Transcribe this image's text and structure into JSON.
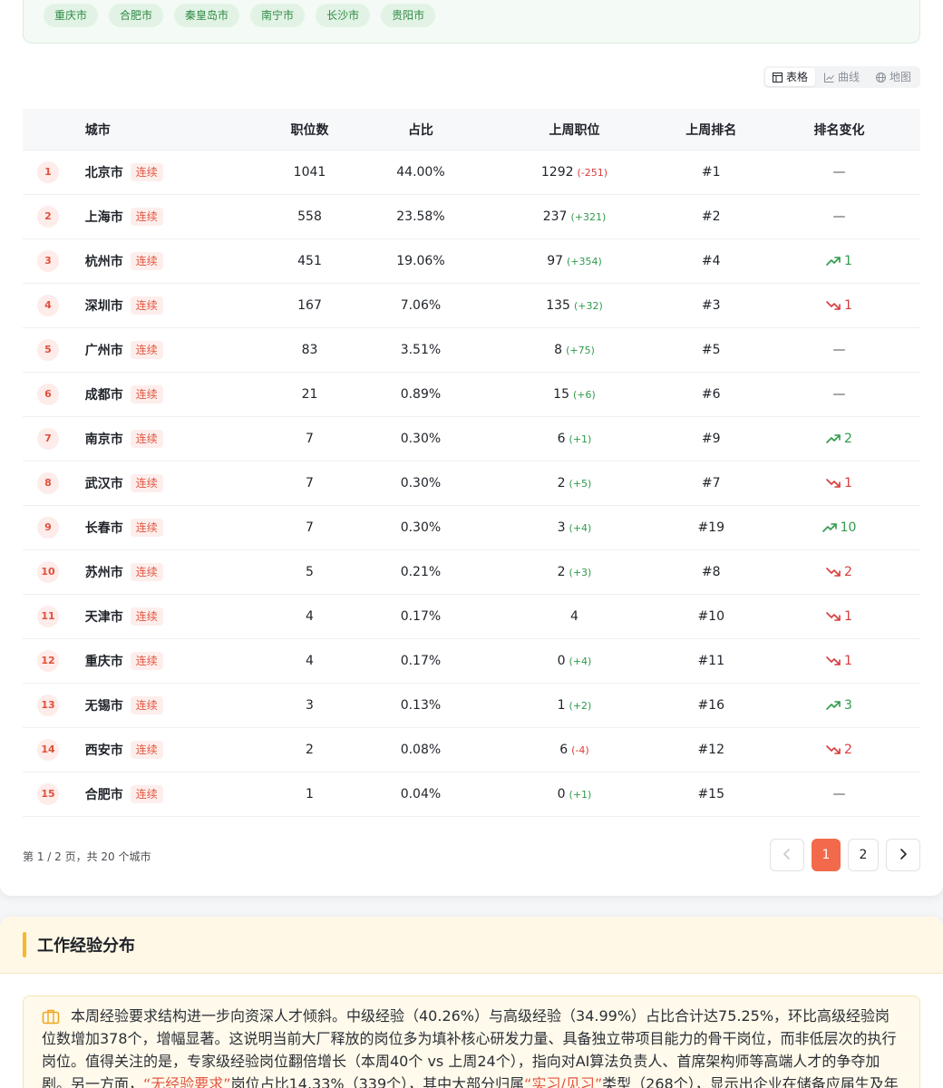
{
  "city_chips": [
    "重庆市",
    "合肥市",
    "秦皇岛市",
    "南宁市",
    "长沙市",
    "贵阳市"
  ],
  "view_toggle": [
    {
      "label": "表格",
      "icon": "table-icon",
      "active": true
    },
    {
      "label": "曲线",
      "icon": "line-chart-icon",
      "active": false
    },
    {
      "label": "地图",
      "icon": "globe-icon",
      "active": false
    }
  ],
  "table": {
    "headers": {
      "city": "城市",
      "jobs": "职位数",
      "share": "占比",
      "last_jobs": "上周职位",
      "last_rank": "上周排名",
      "rank_change": "排名变化"
    },
    "tag_label": "连续",
    "rows": [
      {
        "rank": "1",
        "city": "北京市",
        "jobs": "1041",
        "share": "44.00%",
        "last_jobs": "1292",
        "delta": "(-251)",
        "delta_dir": "down",
        "last_rank": "#1",
        "change": "—",
        "change_dir": "flat"
      },
      {
        "rank": "2",
        "city": "上海市",
        "jobs": "558",
        "share": "23.58%",
        "last_jobs": "237",
        "delta": "(+321)",
        "delta_dir": "up",
        "last_rank": "#2",
        "change": "—",
        "change_dir": "flat"
      },
      {
        "rank": "3",
        "city": "杭州市",
        "jobs": "451",
        "share": "19.06%",
        "last_jobs": "97",
        "delta": "(+354)",
        "delta_dir": "up",
        "last_rank": "#4",
        "change": "1",
        "change_dir": "up"
      },
      {
        "rank": "4",
        "city": "深圳市",
        "jobs": "167",
        "share": "7.06%",
        "last_jobs": "135",
        "delta": "(+32)",
        "delta_dir": "up",
        "last_rank": "#3",
        "change": "1",
        "change_dir": "down"
      },
      {
        "rank": "5",
        "city": "广州市",
        "jobs": "83",
        "share": "3.51%",
        "last_jobs": "8",
        "delta": "(+75)",
        "delta_dir": "up",
        "last_rank": "#5",
        "change": "—",
        "change_dir": "flat"
      },
      {
        "rank": "6",
        "city": "成都市",
        "jobs": "21",
        "share": "0.89%",
        "last_jobs": "15",
        "delta": "(+6)",
        "delta_dir": "up",
        "last_rank": "#6",
        "change": "—",
        "change_dir": "flat"
      },
      {
        "rank": "7",
        "city": "南京市",
        "jobs": "7",
        "share": "0.30%",
        "last_jobs": "6",
        "delta": "(+1)",
        "delta_dir": "up",
        "last_rank": "#9",
        "change": "2",
        "change_dir": "up"
      },
      {
        "rank": "8",
        "city": "武汉市",
        "jobs": "7",
        "share": "0.30%",
        "last_jobs": "2",
        "delta": "(+5)",
        "delta_dir": "up",
        "last_rank": "#7",
        "change": "1",
        "change_dir": "down"
      },
      {
        "rank": "9",
        "city": "长春市",
        "jobs": "7",
        "share": "0.30%",
        "last_jobs": "3",
        "delta": "(+4)",
        "delta_dir": "up",
        "last_rank": "#19",
        "change": "10",
        "change_dir": "up"
      },
      {
        "rank": "10",
        "city": "苏州市",
        "jobs": "5",
        "share": "0.21%",
        "last_jobs": "2",
        "delta": "(+3)",
        "delta_dir": "up",
        "last_rank": "#8",
        "change": "2",
        "change_dir": "down"
      },
      {
        "rank": "11",
        "city": "天津市",
        "jobs": "4",
        "share": "0.17%",
        "last_jobs": "4",
        "delta": "",
        "delta_dir": "",
        "last_rank": "#10",
        "change": "1",
        "change_dir": "down"
      },
      {
        "rank": "12",
        "city": "重庆市",
        "jobs": "4",
        "share": "0.17%",
        "last_jobs": "0",
        "delta": "(+4)",
        "delta_dir": "up",
        "last_rank": "#11",
        "change": "1",
        "change_dir": "down"
      },
      {
        "rank": "13",
        "city": "无锡市",
        "jobs": "3",
        "share": "0.13%",
        "last_jobs": "1",
        "delta": "(+2)",
        "delta_dir": "up",
        "last_rank": "#16",
        "change": "3",
        "change_dir": "up"
      },
      {
        "rank": "14",
        "city": "西安市",
        "jobs": "2",
        "share": "0.08%",
        "last_jobs": "6",
        "delta": "(-4)",
        "delta_dir": "down",
        "last_rank": "#12",
        "change": "2",
        "change_dir": "down"
      },
      {
        "rank": "15",
        "city": "合肥市",
        "jobs": "1",
        "share": "0.04%",
        "last_jobs": "0",
        "delta": "(+1)",
        "delta_dir": "up",
        "last_rank": "#15",
        "change": "—",
        "change_dir": "flat"
      }
    ]
  },
  "pagination": {
    "summary": "第 1 / 2 页，共 20 个城市",
    "pages": [
      "1",
      "2"
    ],
    "current": "1"
  },
  "experience_section": {
    "title": "工作经验分布",
    "insight_part1": "本周经验要求结构进一步向资深人才倾斜。中级经验（40.26%）与高级经验（34.99%）占比合计达75.25%，环比高级经验岗位数增加378个，增幅显著。这说明当前大厂释放的岗位多为填补核心研发力量、具备独立带项目能力的骨干岗位，而非低层次的执行岗位。值得关注的是，专家级经验岗位翻倍增长（本周40个 vs 上周24个），指向对AI算法负责人、首席架构师等高端人才的争夺加剧。另一方面，",
    "insight_hl1": "“无经验要求”",
    "insight_part2": "岗位占比14.33%（339个），其中大部分归属",
    "insight_hl2": "“实习/见习”",
    "insight_part3": "类型（268个），显示出企业在储备应届生及年轻血"
  }
}
